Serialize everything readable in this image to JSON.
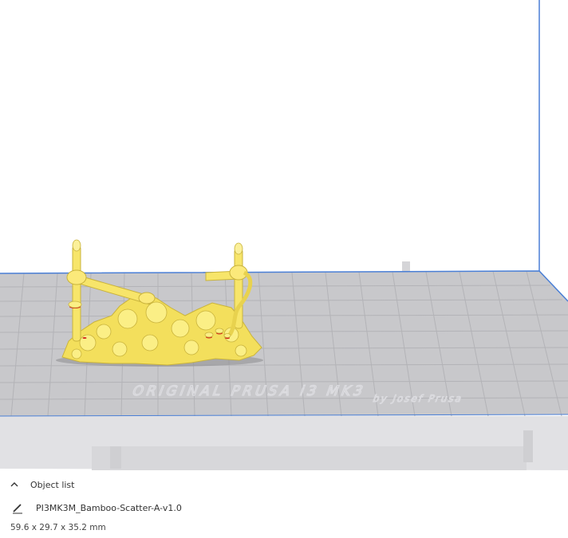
{
  "viewport": {
    "bed_text": "ORIGINAL PRUSA i3 MK3",
    "bed_subtext": "by Josef Prusa",
    "model_color": "#f5e461",
    "model_highlight_color": "#d42a1e",
    "bed_color": "#c9c9cc",
    "grid_color": "#b0b0b4",
    "bed_edge_color": "#4a7fd6"
  },
  "panel": {
    "object_list_label": "Object list",
    "object_name": "PI3MK3M_Bamboo-Scatter-A-v1.0",
    "object_size": "59.6 x 29.7 x 35.2 mm"
  },
  "icons": {
    "collapse": "chevron-up-icon",
    "edit": "pencil-icon"
  }
}
